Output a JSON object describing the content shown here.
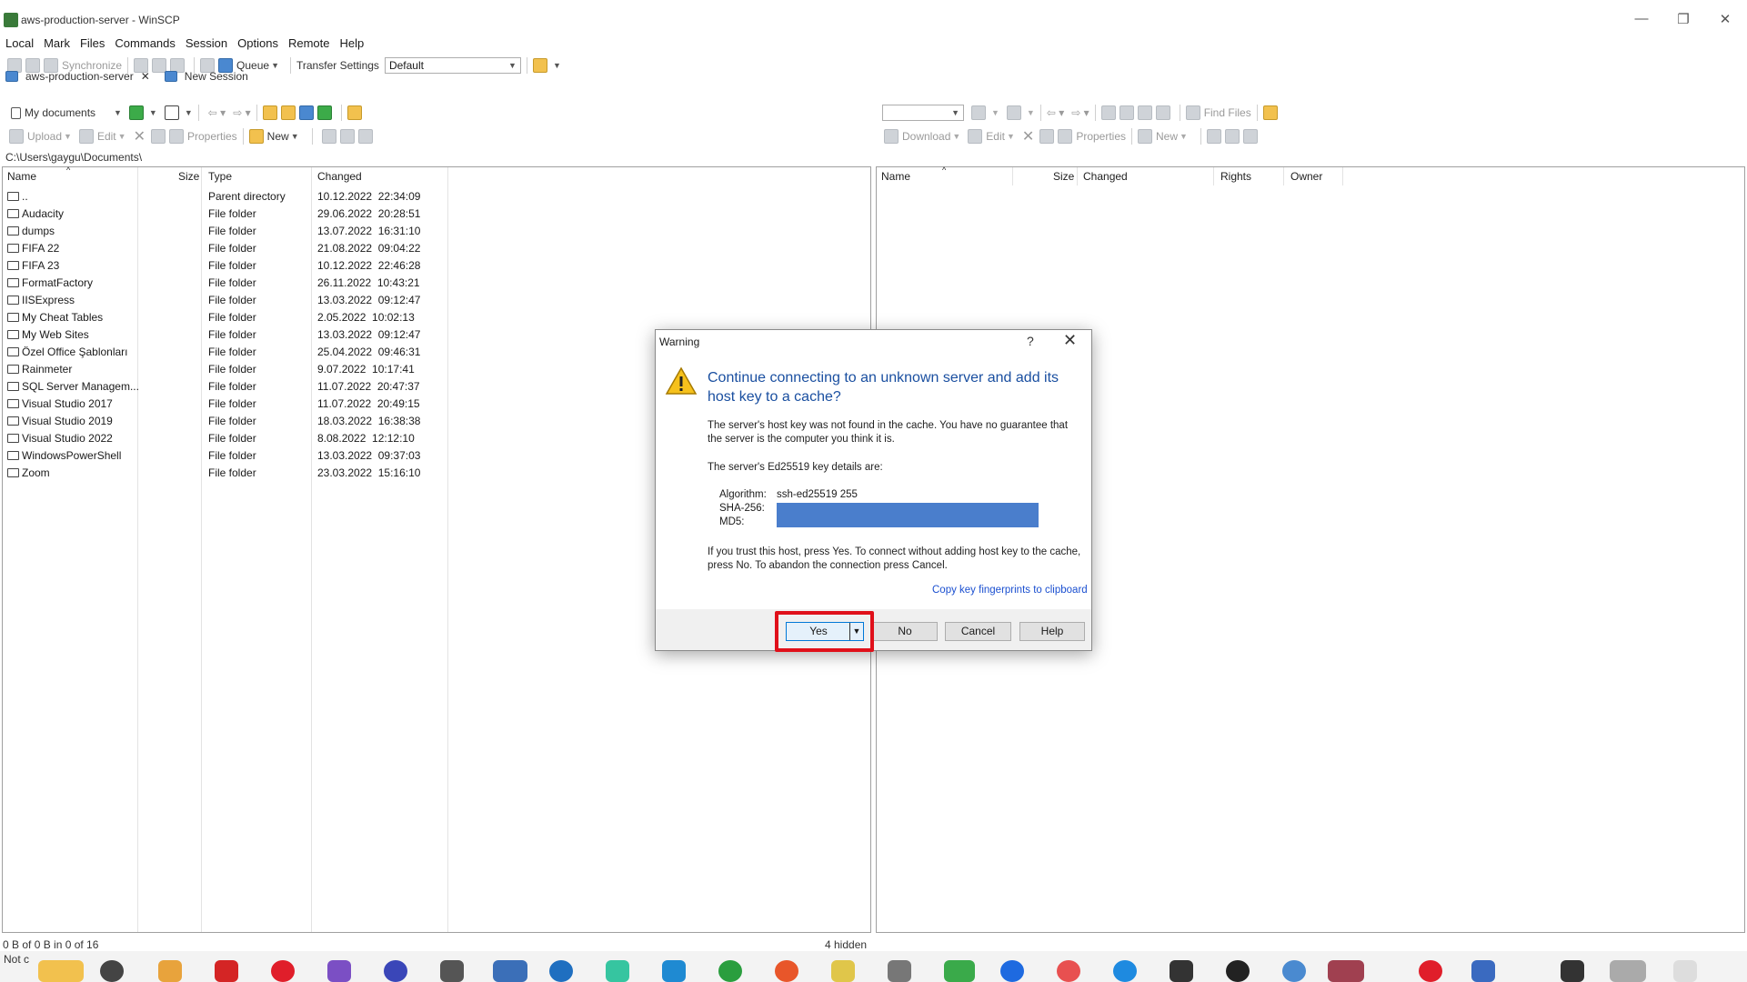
{
  "window": {
    "title": "aws-production-server - WinSCP",
    "minimize": "—",
    "restore": "❐",
    "close": "✕"
  },
  "menu": [
    "Local",
    "Mark",
    "Files",
    "Commands",
    "Session",
    "Options",
    "Remote",
    "Help"
  ],
  "toolbar": {
    "synchronize": "Synchronize",
    "queue": "Queue",
    "transfer_settings_label": "Transfer Settings",
    "transfer_settings_value": "Default"
  },
  "tabs": {
    "session": "aws-production-server",
    "new_session": "New Session"
  },
  "local": {
    "location": "My documents",
    "upload": "Upload",
    "edit": "Edit",
    "properties": "Properties",
    "new": "New",
    "path": "C:\\Users\\gaygu\\Documents\\",
    "columns": {
      "name": "Name",
      "size": "Size",
      "type": "Type",
      "changed": "Changed"
    },
    "rows": [
      {
        "name": "..",
        "type": "Parent directory",
        "changed": "10.12.2022  22:34:09"
      },
      {
        "name": "Audacity",
        "type": "File folder",
        "changed": "29.06.2022  20:28:51"
      },
      {
        "name": "dumps",
        "type": "File folder",
        "changed": "13.07.2022  16:31:10"
      },
      {
        "name": "FIFA 22",
        "type": "File folder",
        "changed": "21.08.2022  09:04:22"
      },
      {
        "name": "FIFA 23",
        "type": "File folder",
        "changed": "10.12.2022  22:46:28"
      },
      {
        "name": "FormatFactory",
        "type": "File folder",
        "changed": "26.11.2022  10:43:21"
      },
      {
        "name": "IISExpress",
        "type": "File folder",
        "changed": "13.03.2022  09:12:47"
      },
      {
        "name": "My Cheat Tables",
        "type": "File folder",
        "changed": "2.05.2022  10:02:13"
      },
      {
        "name": "My Web Sites",
        "type": "File folder",
        "changed": "13.03.2022  09:12:47"
      },
      {
        "name": "Özel Office Şablonları",
        "type": "File folder",
        "changed": "25.04.2022  09:46:31"
      },
      {
        "name": "Rainmeter",
        "type": "File folder",
        "changed": "9.07.2022  10:17:41"
      },
      {
        "name": "SQL Server Managem...",
        "type": "File folder",
        "changed": "11.07.2022  20:47:37"
      },
      {
        "name": "Visual Studio 2017",
        "type": "File folder",
        "changed": "11.07.2022  20:49:15"
      },
      {
        "name": "Visual Studio 2019",
        "type": "File folder",
        "changed": "18.03.2022  16:38:38"
      },
      {
        "name": "Visual Studio 2022",
        "type": "File folder",
        "changed": "8.08.2022  12:12:10"
      },
      {
        "name": "WindowsPowerShell",
        "type": "File folder",
        "changed": "13.03.2022  09:37:03"
      },
      {
        "name": "Zoom",
        "type": "File folder",
        "changed": "23.03.2022  15:16:10"
      }
    ],
    "status": "0 B of 0 B in 0 of 16",
    "hidden": "4 hidden"
  },
  "remote": {
    "find_files": "Find Files",
    "download": "Download",
    "edit": "Edit",
    "properties": "Properties",
    "new": "New",
    "columns": {
      "name": "Name",
      "size": "Size",
      "changed": "Changed",
      "rights": "Rights",
      "owner": "Owner"
    }
  },
  "dialog": {
    "title": "Warning",
    "help_glyph": "?",
    "close_glyph": "✕",
    "heading": "Continue connecting to an unknown server and add its host key to a cache?",
    "p1": "The server's host key was not found in the cache. You have no guarantee that the server is the computer you think it is.",
    "p2": "The server's Ed25519 key details are:",
    "algorithm_label": "Algorithm:",
    "algorithm_value": "ssh-ed25519 255",
    "sha_label": "SHA-256:",
    "md5_label": "MD5:",
    "p3": "If you trust this host, press Yes. To connect without adding host key to the cache, press No. To abandon the connection press Cancel.",
    "copy_link": "Copy key fingerprints to clipboard",
    "buttons": {
      "yes": "Yes",
      "no": "No",
      "cancel": "Cancel",
      "help": "Help"
    }
  },
  "taskbar": {
    "not_connected": "Not c"
  }
}
